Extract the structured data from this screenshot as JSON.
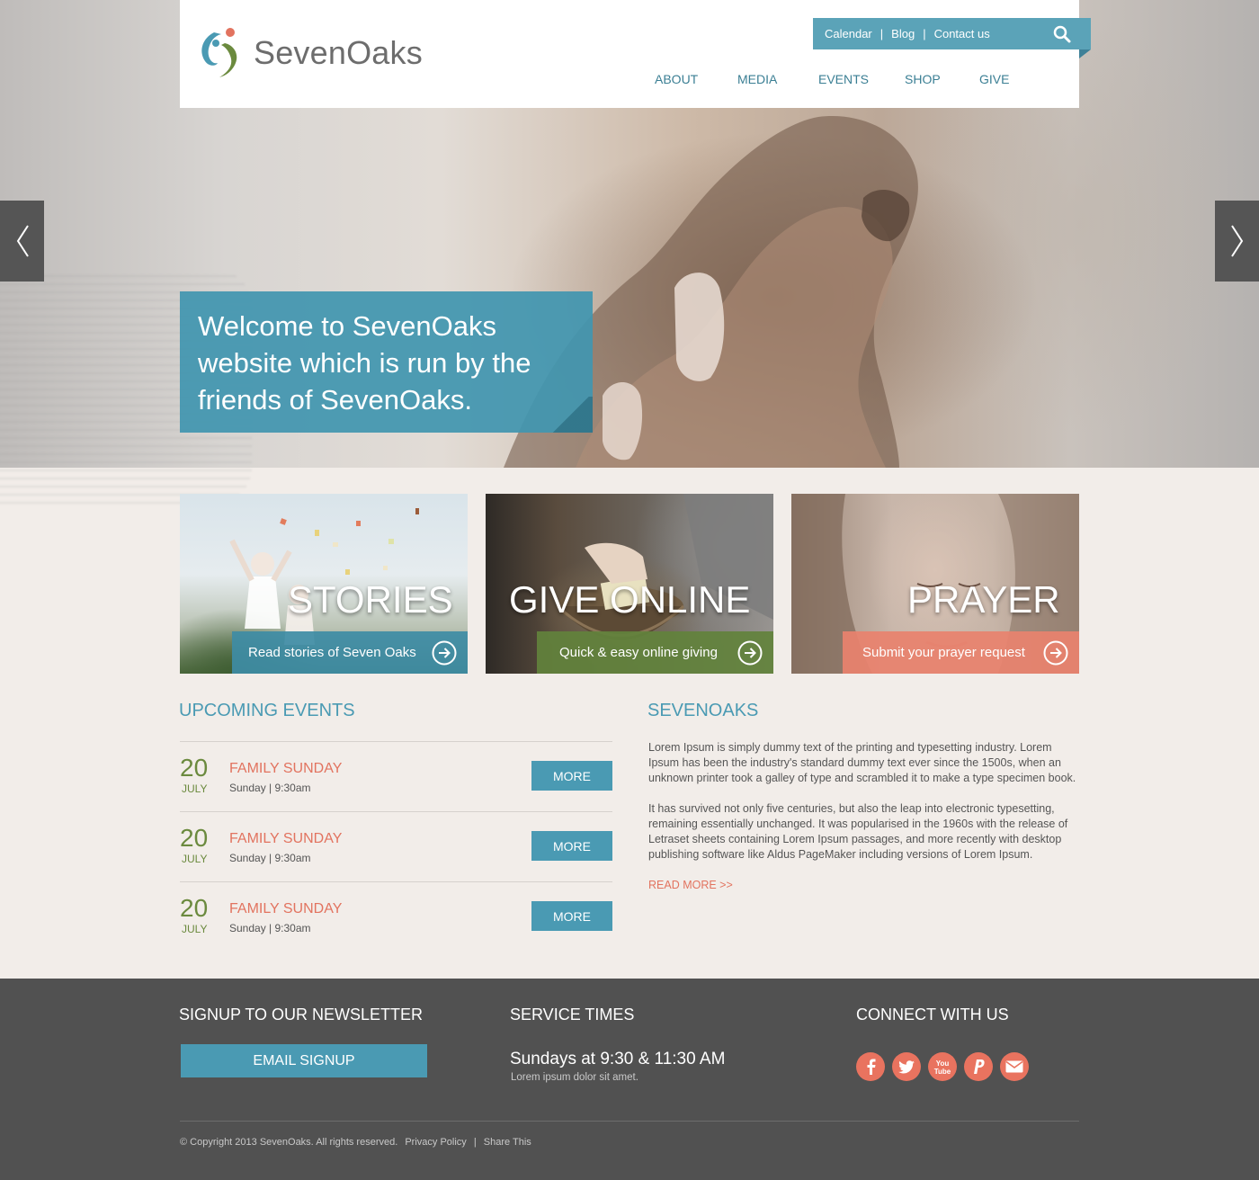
{
  "header": {
    "logo_text": "SevenOaks",
    "top_links": [
      "Calendar",
      "Blog",
      "Contact us"
    ],
    "nav": [
      "ABOUT",
      "MEDIA",
      "EVENTS",
      "SHOP",
      "GIVE"
    ]
  },
  "hero": {
    "welcome_text": "Welcome to SevenOaks website which is run by the friends of SevenOaks."
  },
  "features": [
    {
      "title": "STORIES",
      "link_label": "Read stories of Seven Oaks"
    },
    {
      "title": "GIVE ONLINE",
      "link_label": "Quick & easy online giving"
    },
    {
      "title": "PRAYER",
      "link_label": "Submit your prayer request"
    }
  ],
  "events": {
    "title": "UPCOMING EVENTS",
    "items": [
      {
        "day": "20",
        "month": "JULY",
        "name": "FAMILY SUNDAY",
        "time": "Sunday | 9:30am",
        "button": "MORE"
      },
      {
        "day": "20",
        "month": "JULY",
        "name": "FAMILY SUNDAY",
        "time": "Sunday | 9:30am",
        "button": "MORE"
      },
      {
        "day": "20",
        "month": "JULY",
        "name": "FAMILY SUNDAY",
        "time": "Sunday | 9:30am",
        "button": "MORE"
      }
    ]
  },
  "about": {
    "title": "SEVENOAKS",
    "paragraphs": [
      "Lorem Ipsum is simply dummy text of the printing and typesetting industry. Lorem Ipsum has been the industry's standard dummy text ever since the 1500s, when an unknown printer took a galley of type and scrambled it to make a type specimen book.",
      "It has survived not only five centuries, but also the leap into electronic typesetting, remaining essentially unchanged. It was popularised in the 1960s with the release of Letraset sheets containing Lorem Ipsum passages, and more recently with desktop publishing software like Aldus PageMaker including versions of Lorem Ipsum."
    ],
    "read_more": "READ MORE >>"
  },
  "footer": {
    "newsletter_title": "SIGNUP TO OUR NEWSLETTER",
    "email_button": "EMAIL SIGNUP",
    "service_title": "SERVICE TIMES",
    "service_times": "Sundays at 9:30 & 11:30 AM",
    "service_note": "Lorem ipsum dolor sit amet.",
    "connect_title": "CONNECT WITH US",
    "socials": [
      "facebook-icon",
      "twitter-icon",
      "youtube-icon",
      "paypal-icon",
      "email-icon"
    ],
    "copyright": "© Copyright 2013 SevenOaks. All rights reserved.",
    "links": [
      "Privacy Policy",
      "Share This"
    ]
  },
  "colors": {
    "accent_blue": "#4a9ab3",
    "accent_coral": "#e2735f",
    "accent_green": "#6b8a3e",
    "footer_bg": "#515151",
    "page_bg": "#f2ede9"
  }
}
